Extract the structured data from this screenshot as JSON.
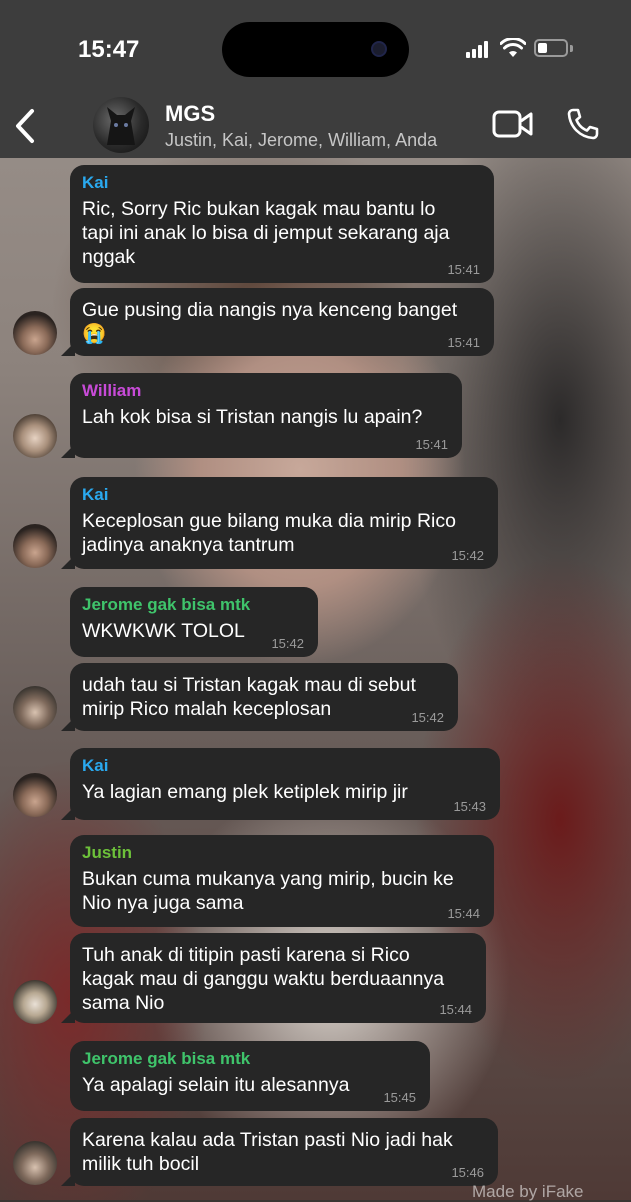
{
  "status_bar": {
    "time": "15:47",
    "battery_level": 0.35
  },
  "header": {
    "group_name": "MGS",
    "members": "Justin, Kai, Jerome, William, Anda"
  },
  "colors": {
    "Kai": "#2aa9ef",
    "William": "#c84bd8",
    "Jerome": "#3fc46b",
    "Justin": "#6dc13a"
  },
  "messages": [
    {
      "sender": "Kai",
      "text": "Ric, Sorry Ric bukan kagak mau bantu lo\ntapi ini anak lo bisa di jemput sekarang aja\nnggak",
      "time": "15:41"
    },
    {
      "sender": "",
      "text": "Gue pusing dia nangis nya kenceng banget\n😭",
      "time": "15:41"
    },
    {
      "sender": "William",
      "text": "Lah kok bisa si Tristan nangis lu apain?",
      "time": "15:41"
    },
    {
      "sender": "Kai",
      "text": "Keceplosan gue bilang muka dia mirip Rico\njadinya anaknya tantrum",
      "time": "15:42"
    },
    {
      "sender": "Jerome gak bisa mtk",
      "text": "WKWKWK TOLOL",
      "time": "15:42"
    },
    {
      "sender": "",
      "text": "udah tau si Tristan kagak mau di sebut\nmirip Rico malah keceplosan",
      "time": "15:42"
    },
    {
      "sender": "Kai",
      "text": "Ya lagian emang plek ketiplek mirip jir",
      "time": "15:43"
    },
    {
      "sender": "Justin",
      "text": "Bukan cuma mukanya yang mirip, bucin ke\nNio nya juga sama",
      "time": "15:44"
    },
    {
      "sender": "",
      "text": "Tuh anak di titipin pasti karena si Rico\nkagak mau di ganggu waktu berduaannya\nsama Nio",
      "time": "15:44"
    },
    {
      "sender": "Jerome gak bisa mtk",
      "text": "Ya apalagi selain itu alesannya",
      "time": "15:45"
    },
    {
      "sender": "",
      "text": "Karena kalau ada Tristan pasti Nio jadi hak\nmilik tuh bocil",
      "time": "15:46"
    }
  ],
  "watermark": "Made by iFake"
}
